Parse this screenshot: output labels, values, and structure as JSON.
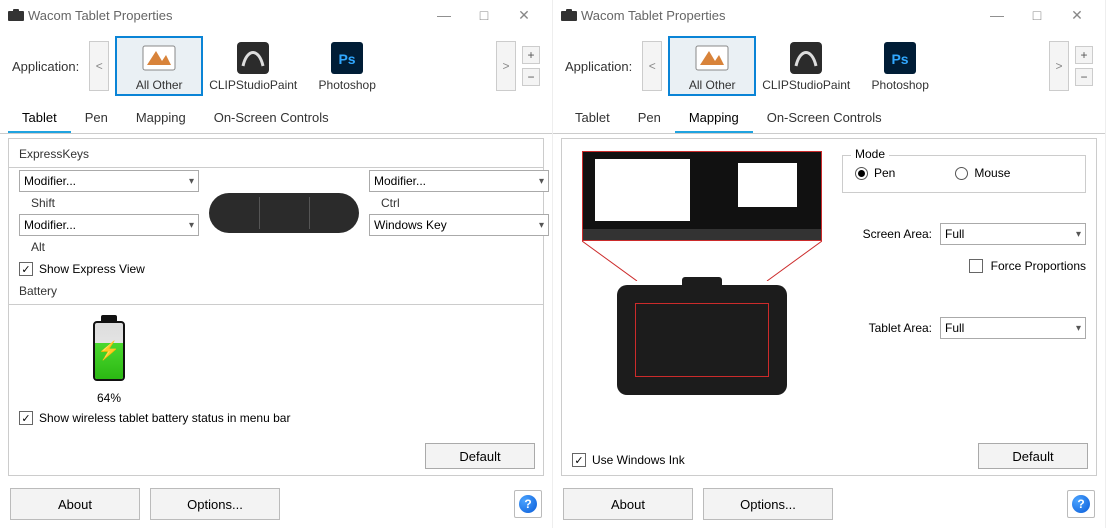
{
  "window_title": "Wacom Tablet Properties",
  "app_strip": {
    "label": "Application:",
    "prev": "<",
    "next": ">",
    "plus": "+",
    "minus": "−",
    "items": [
      {
        "label": "All Other",
        "selected": true
      },
      {
        "label": "CLIPStudioPaint",
        "selected": false
      },
      {
        "label": "Photoshop",
        "selected": false
      }
    ]
  },
  "tabs": [
    "Tablet",
    "Pen",
    "Mapping",
    "On-Screen Controls"
  ],
  "left_active_tab": 0,
  "right_active_tab": 2,
  "expresskeys": {
    "group_label": "ExpressKeys",
    "slots": [
      {
        "type": "Modifier...",
        "value": "Shift"
      },
      {
        "type": "Modifier...",
        "value": "Alt"
      },
      {
        "type": "Modifier...",
        "value": "Ctrl"
      },
      {
        "type": "Windows Key",
        "value": ""
      }
    ],
    "show_express_view": {
      "label": "Show Express View",
      "checked": true
    }
  },
  "battery": {
    "group_label": "Battery",
    "percent_label": "64%",
    "percent": 64,
    "show_status": {
      "label": "Show wireless tablet battery status in menu bar",
      "checked": true
    }
  },
  "mapping": {
    "mode": {
      "label": "Mode",
      "options": [
        "Pen",
        "Mouse"
      ],
      "selected": "Pen"
    },
    "screen_area": {
      "label": "Screen Area:",
      "value": "Full"
    },
    "force_proportions": {
      "label": "Force Proportions",
      "checked": false
    },
    "tablet_area": {
      "label": "Tablet Area:",
      "value": "Full"
    },
    "use_windows_ink": {
      "label": "Use Windows Ink",
      "checked": true
    }
  },
  "buttons": {
    "default": "Default",
    "about": "About",
    "options": "Options..."
  },
  "colors": {
    "accent": "#1fa3e0",
    "selection": "#0a84d6",
    "mapping_outline": "#cc2b2b"
  }
}
